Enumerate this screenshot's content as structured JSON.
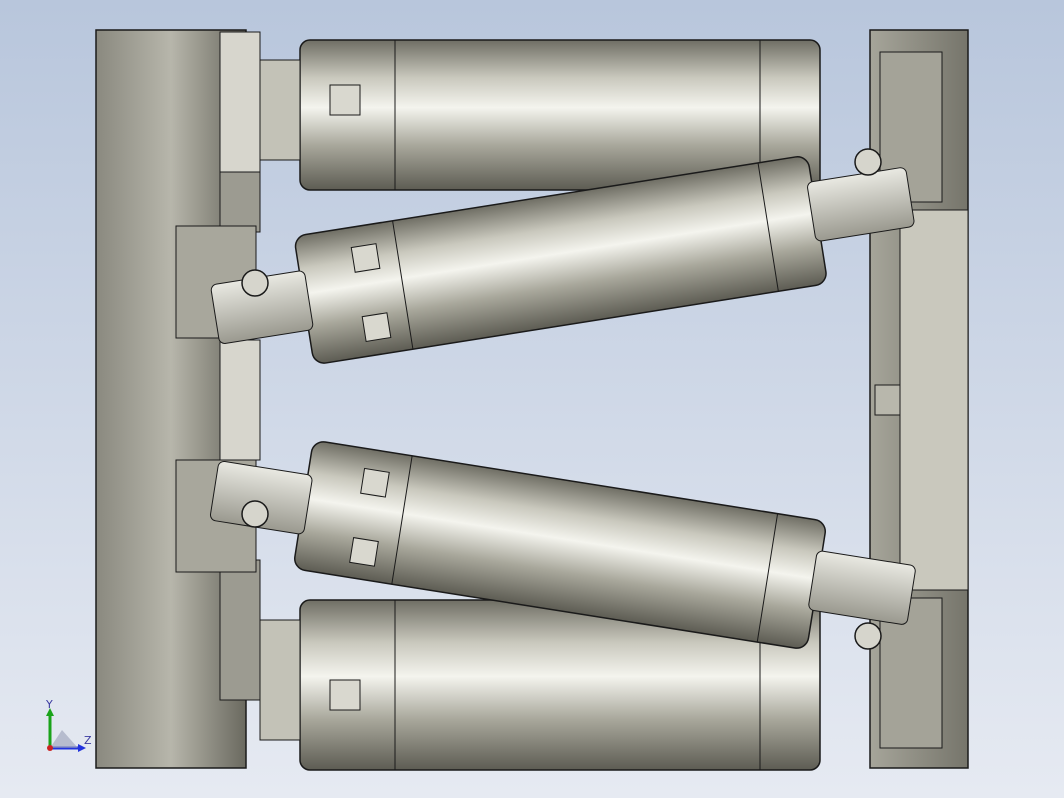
{
  "viewport": {
    "background_top": "#b8c6dc",
    "background_bottom": "#e6eaf2",
    "metal_dark": "#6f6e64",
    "metal_mid": "#b4b3a8",
    "metal_light": "#efefe8",
    "edge_color": "#1a1a1a"
  },
  "triad": {
    "y_label": "Y",
    "z_label": "Z",
    "y_color": "#1aa31a",
    "z_color": "#2233dd",
    "x_color": "#cc2222"
  }
}
